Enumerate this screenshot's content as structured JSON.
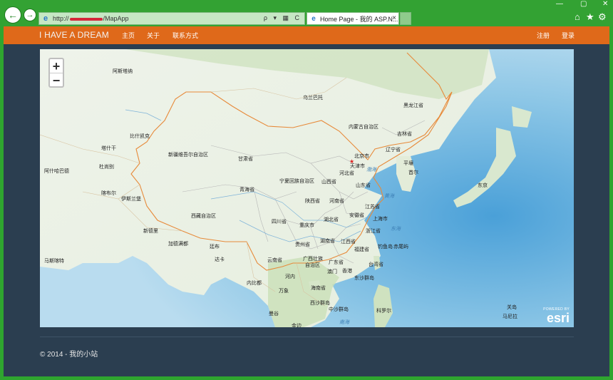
{
  "browser": {
    "url_prefix": "http://",
    "url_suffix": "/MapApp",
    "tab_title": "Home Page - 我的 ASP.N...",
    "address_tools": "ρ ▾ ▦ C",
    "tab_close": "×",
    "back_glyph": "←",
    "forward_glyph": "→",
    "min_glyph": "—",
    "max_glyph": "▢",
    "close_glyph": "✕",
    "home_glyph": "⌂",
    "star_glyph": "★",
    "gear_glyph": "⚙",
    "ie_glyph": "e",
    "colors": {
      "frame": "#33a233",
      "address_bg": "#c6e7c4"
    }
  },
  "navbar": {
    "brand": "I HAVE A DREAM",
    "links": [
      "主页",
      "关于",
      "联系方式"
    ],
    "right_links": [
      "注册",
      "登录"
    ],
    "color": "#df691a"
  },
  "map": {
    "zoom_in": "+",
    "zoom_out": "−",
    "attribution_top": "POWERED BY",
    "attribution_logo": "esri",
    "labels": {
      "ahst": "阿斯塔纳",
      "wlmq": "乌兰巴托",
      "bsk": "比什凯克",
      "tsh": "塔什干",
      "dsb": "杜尚别",
      "ash": "阿什哈巴德",
      "kbl": "喀布尔",
      "isl": "伊斯兰堡",
      "ndl": "新德里",
      "ktm": "加德满都",
      "thm": "廷布",
      "dhk": "达卡",
      "mkt": "马斯喀特",
      "xj": "新疆维吾尔自治区",
      "xz": "西藏自治区",
      "qh": "青海省",
      "gs": "甘肃省",
      "nm": "内蒙古自治区",
      "hlj": "黑龙江省",
      "jl": "吉林省",
      "ln": "辽宁省",
      "bj": "北京市",
      "tj": "天津市",
      "hb": "河北省",
      "sx": "山西省",
      "sd": "山东省",
      "nx": "宁夏回族自治区",
      "sxi": "陕西省",
      "hn": "河南省",
      "js": "江苏省",
      "ah": "安徽省",
      "sh": "上海市",
      "hub": "湖北省",
      "sc": "四川省",
      "cq": "重庆市",
      "zj": "浙江省",
      "gz": "贵州省",
      "hun": "湖南省",
      "jx": "江西省",
      "fj": "福建省",
      "yn": "云南省",
      "gx": "广西壮族",
      "gx2": "自治区",
      "gd": "广东省",
      "tw": "台湾省",
      "hk": "香港",
      "mo": "澳门",
      "hain": "海南省",
      "pyy": "平壤",
      "seoul": "首尔",
      "tokyo": "东京",
      "vtn": "万象",
      "hn2": "河内",
      "npd": "内比都",
      "mnl": "马尼拉",
      "bkk": "曼谷",
      "pnh": "金边",
      "bhs": "渤海",
      "hhs": "黄海",
      "dhs": "东海",
      "nhs": "南海",
      "dsq": "东沙群岛",
      "xsq": "西沙群岛",
      "zsq": "中沙群岛",
      "dyd": "钓鱼岛",
      "cwd": "赤尾屿",
      "hgd": "关岛",
      "kyn": "科罗尔",
      "dl": "达卡",
      "xg": "马尼拉"
    }
  },
  "footer": {
    "text": "© 2014 - 我的小站"
  },
  "page_colors": {
    "background": "#2b3e50",
    "footer_text": "#e6e6e6"
  }
}
